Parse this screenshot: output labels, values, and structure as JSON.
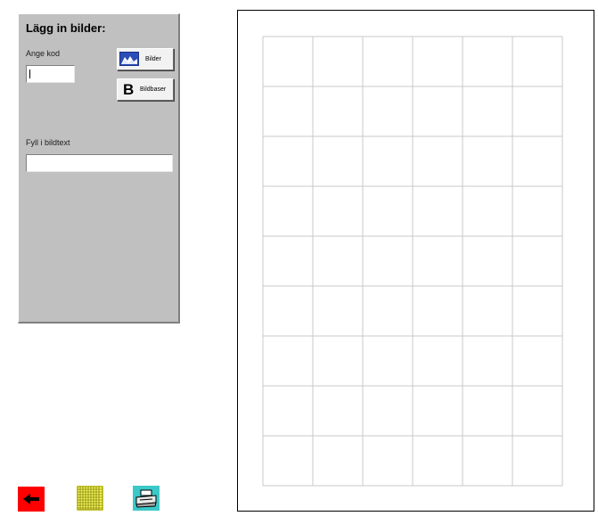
{
  "panel": {
    "title": "Lägg in bilder:",
    "code_label": "Ange kod",
    "code_value": "",
    "caption_label": "Fyll i bildtext",
    "caption_value": "",
    "buttons": {
      "images_label": "Bilder",
      "images_icon": "photo-icon",
      "image_banks_label": "Bildbaser",
      "image_banks_letter": "B"
    }
  },
  "page_grid": {
    "columns": 6,
    "rows": 9,
    "line_color": "#c8c8c8"
  },
  "toolbar": {
    "back_icon": "arrow-left-icon",
    "back_color": "#ff0000",
    "grid_icon": "grid-icon",
    "grid_color": "#ffff66",
    "print_icon": "printer-icon",
    "print_color": "#3cc8c8"
  }
}
